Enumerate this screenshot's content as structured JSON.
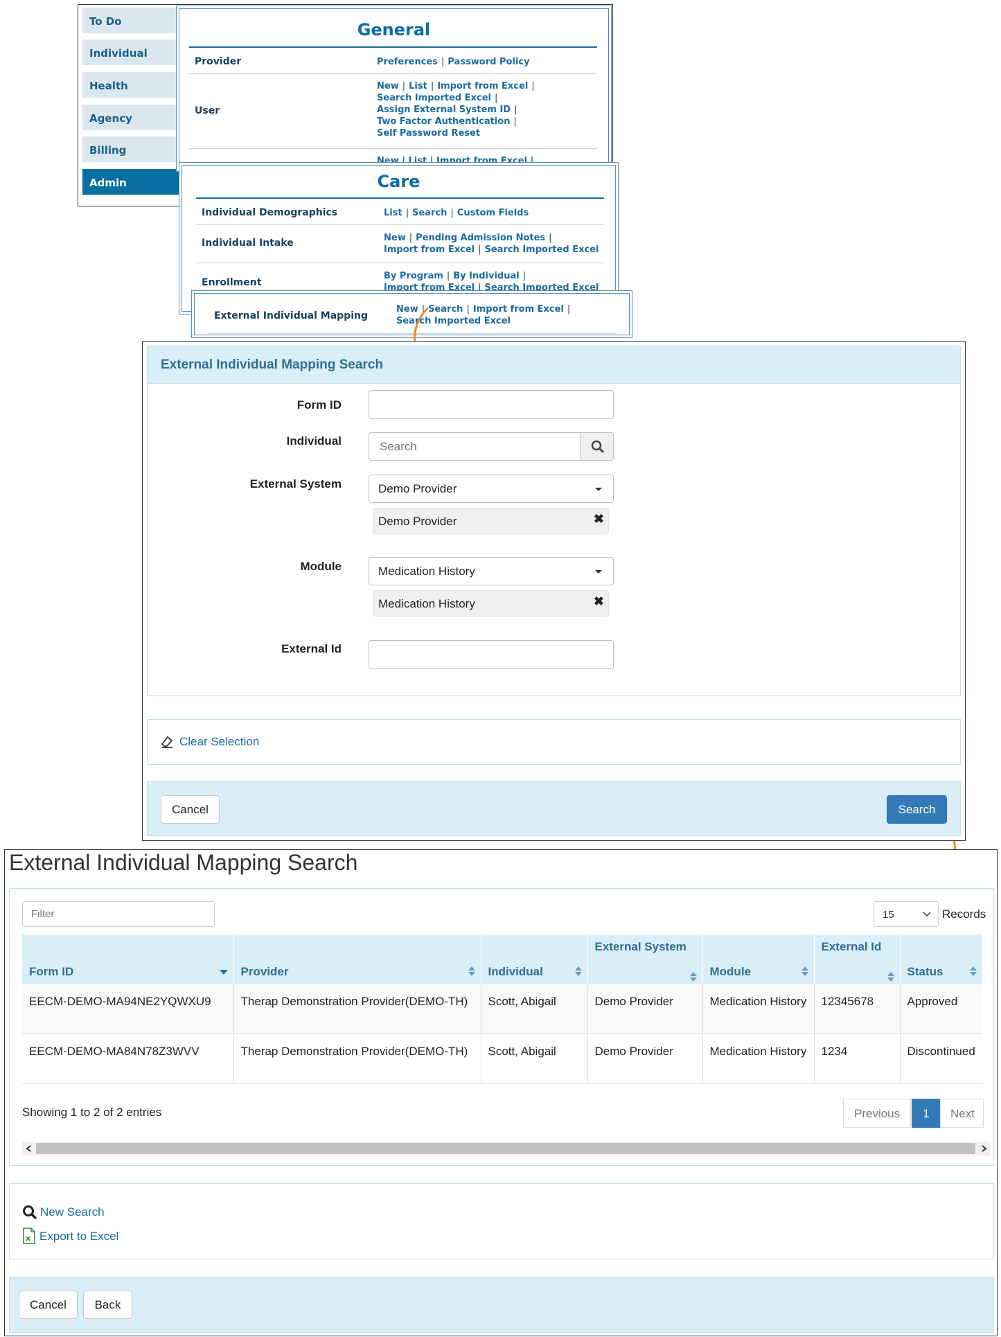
{
  "nav": {
    "tabs": [
      {
        "label": "To Do"
      },
      {
        "label": "Individual"
      },
      {
        "label": "Health"
      },
      {
        "label": "Agency"
      },
      {
        "label": "Billing"
      },
      {
        "label": "Admin"
      }
    ]
  },
  "general": {
    "title": "General",
    "rows": [
      {
        "label": "Provider",
        "links": [
          "Preferences",
          "Password Policy"
        ]
      },
      {
        "label": "User",
        "links": [
          "New",
          "List",
          "Import from Excel",
          "Search Imported Excel",
          "Assign External System ID",
          "Two Factor Authentication",
          "Self Password Reset"
        ]
      },
      {
        "partial_links": "New | List | Import from Excel |"
      }
    ]
  },
  "care": {
    "title": "Care",
    "rows": [
      {
        "label": "Individual Demographics",
        "links": [
          "List",
          "Search",
          "Custom Fields"
        ]
      },
      {
        "label": "Individual Intake",
        "links": [
          "New",
          "Pending Admission Notes",
          "Import from Excel",
          "Search Imported Excel"
        ]
      },
      {
        "label": "Enrollment",
        "links": [
          "By Program",
          "By Individual",
          "Import from Excel",
          "Search Imported Excel"
        ]
      }
    ]
  },
  "mapping_row": {
    "label": "External Individual Mapping",
    "links": [
      "New",
      "Search",
      "Import from Excel",
      "Search Imported Excel"
    ]
  },
  "search_form": {
    "title": "External Individual Mapping Search",
    "fields": {
      "form_id": {
        "label": "Form ID",
        "value": ""
      },
      "individual": {
        "label": "Individual",
        "placeholder": "Search"
      },
      "external_system": {
        "label": "External System",
        "selected": "Demo Provider",
        "chip": "Demo Provider"
      },
      "module": {
        "label": "Module",
        "selected": "Medication History",
        "chip": "Medication History"
      },
      "external_id": {
        "label": "External Id",
        "value": ""
      }
    },
    "clear_selection": "Clear Selection",
    "cancel": "Cancel",
    "search": "Search"
  },
  "results": {
    "title": "External Individual Mapping Search",
    "filter_placeholder": "Filter",
    "records_value": "15",
    "records_label": "Records",
    "columns": [
      "Form ID",
      "Provider",
      "Individual",
      "External System",
      "Module",
      "External Id",
      "Status"
    ],
    "rows": [
      {
        "form_id": "EECM-DEMO-MA94NE2YQWXU9",
        "provider": "Therap Demonstration Provider(DEMO-TH)",
        "individual": "Scott, Abigail",
        "external_system": "Demo Provider",
        "module": "Medication History",
        "external_id": "12345678",
        "status": "Approved"
      },
      {
        "form_id": "EECM-DEMO-MA84N78Z3WVV",
        "provider": "Therap Demonstration Provider(DEMO-TH)",
        "individual": "Scott, Abigail",
        "external_system": "Demo Provider",
        "module": "Medication History",
        "external_id": "1234",
        "status": "Discontinued"
      }
    ],
    "showing": "Showing 1 to 2 of 2 entries",
    "pagination": {
      "previous": "Previous",
      "current": "1",
      "next": "Next"
    },
    "new_search": "New Search",
    "export": "Export to Excel",
    "cancel": "Cancel",
    "back": "Back"
  },
  "colors": {
    "accent": "#337ab7",
    "nav_active": "#086fa1",
    "panel_bg": "#daeef7",
    "arrow": "#f0892a"
  }
}
